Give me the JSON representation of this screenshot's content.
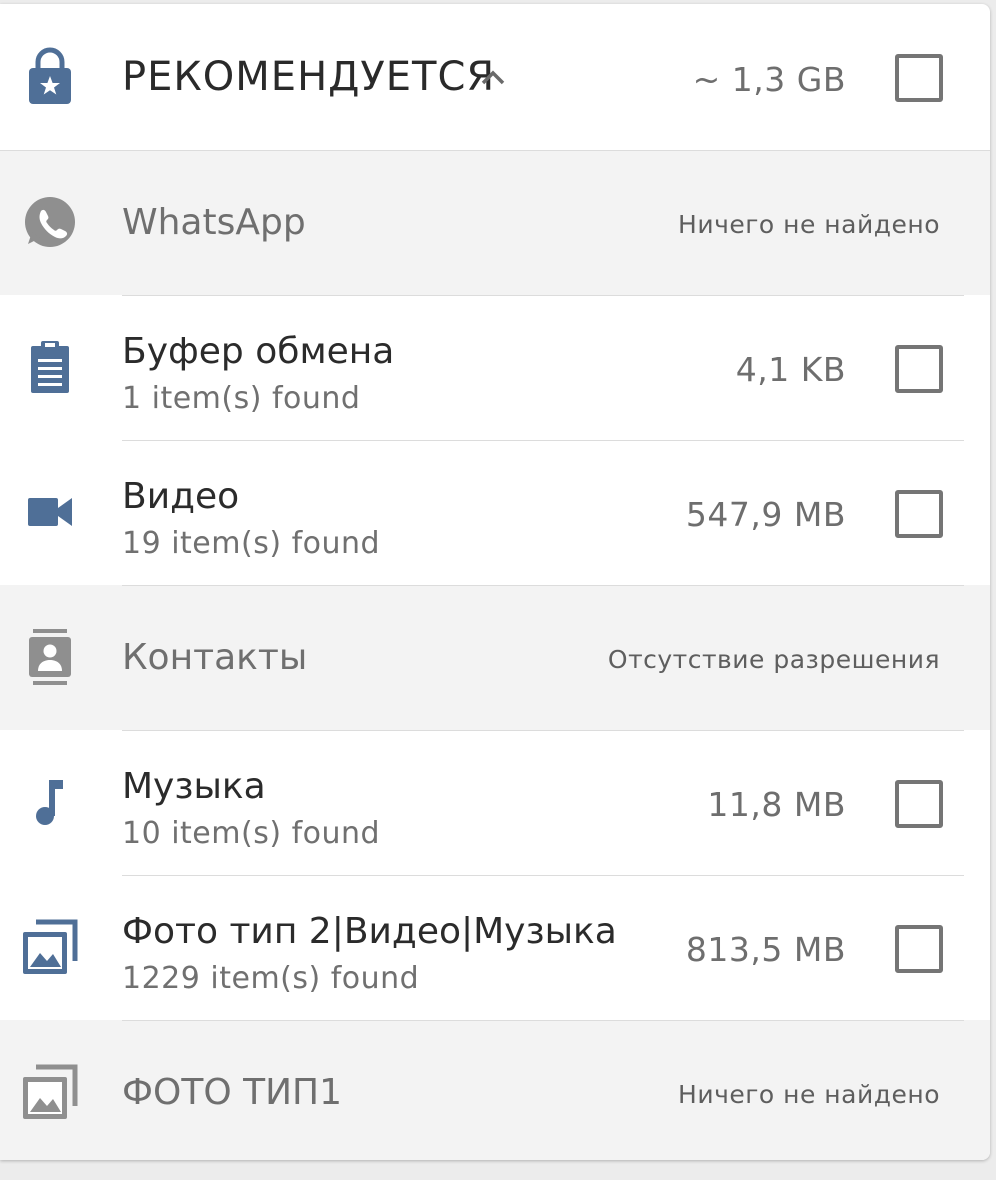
{
  "header": {
    "title": "РЕКОМЕНДУЕТСЯ",
    "size": "~ 1,3 GB",
    "lock_icon": "lock-star-icon",
    "chevron_icon": "chevron-up-icon"
  },
  "items": [
    {
      "title": "WhatsApp",
      "status": "Ничего не найдено",
      "icon": "whatsapp-icon"
    },
    {
      "title": "Буфер обмена",
      "subtitle": "1 item(s) found",
      "size": "4,1 KB",
      "icon": "clipboard-icon"
    },
    {
      "title": "Видео",
      "subtitle": "19 item(s) found",
      "size": "547,9 MB",
      "icon": "video-camera-icon"
    },
    {
      "title": "Контакты",
      "status": "Отсутствие разрешения",
      "icon": "contacts-icon"
    },
    {
      "title": "Музыка",
      "subtitle": "10 item(s) found",
      "size": "11,8 MB",
      "icon": "music-note-icon"
    },
    {
      "title": "Фото тип 2|Видео|Музыка",
      "subtitle": "1229 item(s) found",
      "size": "813,5 MB",
      "icon": "photo-library-icon"
    },
    {
      "title": "ФОТО ТИП1",
      "status": "Ничего не найдено",
      "icon": "photo-library-icon"
    }
  ],
  "colors": {
    "icon_blue": "#4f6f97",
    "icon_gray": "#8f8f8f",
    "disabled_bg": "#f3f3f3"
  }
}
